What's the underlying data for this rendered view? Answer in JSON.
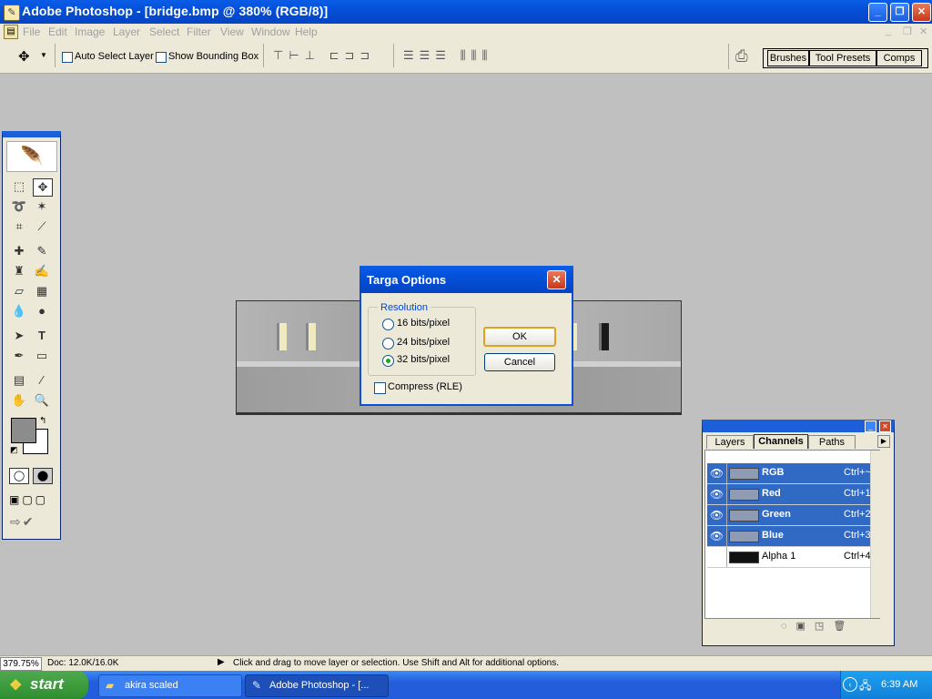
{
  "window": {
    "title": "Adobe Photoshop - [bridge.bmp @ 380% (RGB/8)]",
    "minimize_glyph": "_",
    "maximize_glyph": "❐",
    "close_glyph": "✕"
  },
  "menubar": [
    "File",
    "Edit",
    "Image",
    "Layer",
    "Select",
    "Filter",
    "View",
    "Window",
    "Help"
  ],
  "options": {
    "auto_select_label": "Auto Select Layer",
    "bounding_box_label": "Show Bounding Box",
    "auto_select_checked": false,
    "bounding_box_checked": false
  },
  "palette_well": [
    "Brushes",
    "Tool Presets",
    "Comps"
  ],
  "dialog": {
    "title": "Targa Options",
    "group_label": "Resolution",
    "options": [
      "16 bits/pixel",
      "24 bits/pixel",
      "32 bits/pixel"
    ],
    "selected": "32 bits/pixel",
    "compress_label": "Compress (RLE)",
    "compress_checked": false,
    "ok_label": "OK",
    "cancel_label": "Cancel"
  },
  "panel": {
    "tabs": [
      "Layers",
      "Channels",
      "Paths"
    ],
    "active_tab": "Channels",
    "channels": [
      {
        "name": "RGB",
        "shortcut": "Ctrl+~",
        "visible": true,
        "selected": true
      },
      {
        "name": "Red",
        "shortcut": "Ctrl+1",
        "visible": true,
        "selected": true
      },
      {
        "name": "Green",
        "shortcut": "Ctrl+2",
        "visible": true,
        "selected": true
      },
      {
        "name": "Blue",
        "shortcut": "Ctrl+3",
        "visible": true,
        "selected": true
      },
      {
        "name": "Alpha 1",
        "shortcut": "Ctrl+4",
        "visible": false,
        "selected": false
      }
    ]
  },
  "status": {
    "zoom": "379.75%",
    "doc": "Doc: 12.0K/16.0K",
    "message": "Click and drag to move layer or selection.  Use Shift and Alt for additional options."
  },
  "taskbar": {
    "start_label": "start",
    "tasks": [
      "akira scaled",
      "Adobe Photoshop - [..."
    ],
    "clock": "6:39 AM"
  },
  "icons": {
    "eye": "eye-icon",
    "close": "close-icon",
    "folder": "folder-icon"
  }
}
